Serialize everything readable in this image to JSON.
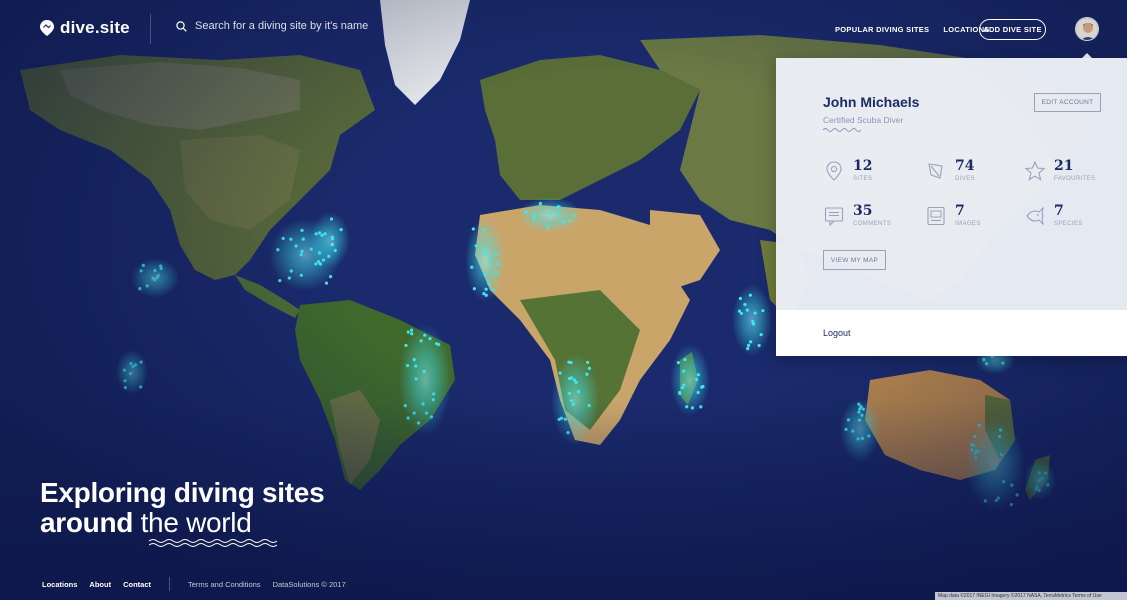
{
  "header": {
    "logo_text": "dive.site",
    "search_placeholder": "Search for a diving site by it's name",
    "nav": [
      {
        "label": "POPULAR DIVING SITES"
      },
      {
        "label": "LOCATIONS"
      }
    ],
    "add_button": "ADD DIVE SITE"
  },
  "account_panel": {
    "name": "John Michaels",
    "title": "Certified Scuba Diver",
    "edit_button": "EDIT ACCOUNT",
    "stats": [
      {
        "icon": "location-pin-icon",
        "value": "12",
        "label": "SITES"
      },
      {
        "icon": "dive-flag-icon",
        "value": "74",
        "label": "DIVES"
      },
      {
        "icon": "star-icon",
        "value": "21",
        "label": "FAVOURITES"
      },
      {
        "icon": "comment-icon",
        "value": "35",
        "label": "COMMENTS"
      },
      {
        "icon": "image-icon",
        "value": "7",
        "label": "IMAGES"
      },
      {
        "icon": "fish-icon",
        "value": "7",
        "label": "SPECIES"
      }
    ],
    "view_map_button": "VIEW MY MAP",
    "logout": "Logout"
  },
  "hero": {
    "line1": "Exploring diving sites",
    "line2_bold": "around",
    "line2_light": "the world"
  },
  "footer": {
    "links": [
      {
        "label": "Locations"
      },
      {
        "label": "About"
      },
      {
        "label": "Contact"
      }
    ],
    "terms": "Terms and Conditions",
    "copyright": "DataSolutions © 2017"
  },
  "map_attribution": "Map data ©2017 INEGI Imagery ©2017 NASA, TerraMetrics  Terms of Use",
  "colors": {
    "accent": "#1c2a66",
    "ocean": "#1a2a6c",
    "dive_spot": "#3fe6f0"
  }
}
